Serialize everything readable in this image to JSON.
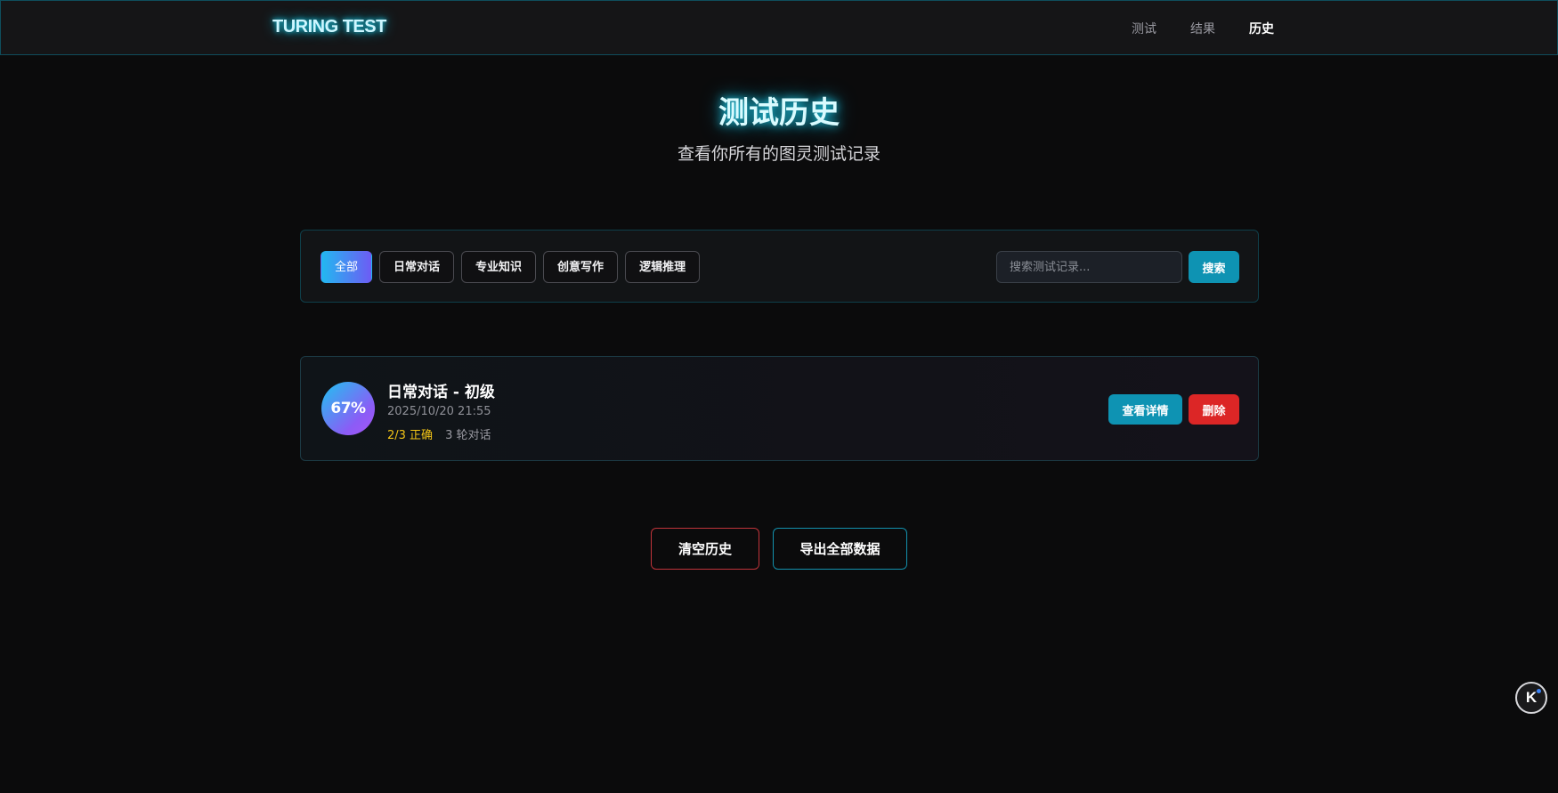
{
  "header": {
    "logo": "TURING TEST",
    "nav": [
      {
        "label": "测试",
        "active": false
      },
      {
        "label": "结果",
        "active": false
      },
      {
        "label": "历史",
        "active": true
      }
    ]
  },
  "hero": {
    "title": "测试历史",
    "subtitle": "查看你所有的图灵测试记录"
  },
  "filters": {
    "chips": [
      {
        "label": "全部",
        "active": true
      },
      {
        "label": "日常对话",
        "active": false
      },
      {
        "label": "专业知识",
        "active": false
      },
      {
        "label": "创意写作",
        "active": false
      },
      {
        "label": "逻辑推理",
        "active": false
      }
    ],
    "search_placeholder": "搜索测试记录...",
    "search_button": "搜索"
  },
  "records": [
    {
      "score": "67%",
      "title": "日常对话 - 初级",
      "date": "2025/10/20 21:55",
      "correct": "2/3 正确",
      "rounds": "3 轮对话",
      "detail_button": "查看详情",
      "delete_button": "删除"
    }
  ],
  "actions": {
    "clear": "清空历史",
    "export": "导出全部数据"
  },
  "floating": {
    "icon": "k-assistant-icon",
    "glyph": "K"
  },
  "colors": {
    "accent_cyan": "#0e93b3",
    "danger_red": "#dc2626",
    "correct_yellow": "#f2c417",
    "background": "#0b0b0c"
  }
}
